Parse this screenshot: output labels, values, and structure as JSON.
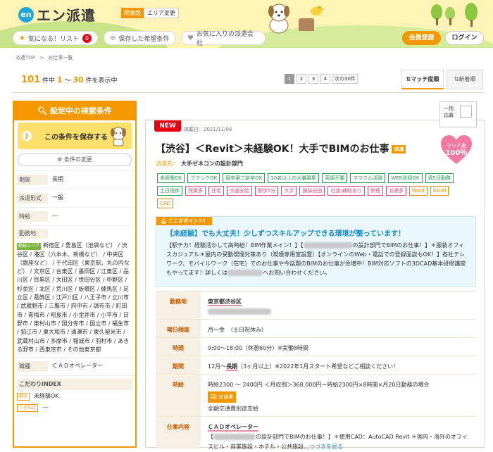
{
  "header": {
    "logo_mark": "en",
    "brand": "エン派遣",
    "region_current": "関東版",
    "region_change": "エリア変更",
    "nav": [
      {
        "label": "気になる！リスト",
        "icon": "star-icon",
        "count": "0"
      },
      {
        "label": "保存した希望条件",
        "icon": "search-icon"
      },
      {
        "label": "お気に入りの派遣会社",
        "icon": "heart-icon"
      }
    ],
    "register": "会員登録",
    "login": "ログイン"
  },
  "breadcrumb": [
    "派遣TOP",
    ">",
    "お仕事一覧"
  ],
  "results": {
    "total": "101",
    "total_unit": "件中",
    "from": "1",
    "sep": "〜",
    "to": "30",
    "suffix": "件を表示中"
  },
  "pager": {
    "pages": [
      "1",
      "2",
      "3",
      "4"
    ],
    "current": "1",
    "next": "次の30件"
  },
  "sort": {
    "match": "マッチ度順",
    "new": "新着順"
  },
  "sidebar": {
    "title": "設定中の検索条件",
    "save": "この条件を保存する",
    "change": "条件の変更",
    "period_label": "期間",
    "period": "長期",
    "type_label": "派遣形式",
    "type": "一般",
    "hours_label": "時給",
    "hours": "---",
    "area_label": "勤務地",
    "area_tag": "勤務エリア",
    "area_text": "新宿区 / 豊島区（池袋など） / 渋谷区 / 港区（六本木、新橋など） / 中央区（銀座など） / 千代田区（東京駅、丸の内など） / 文京区 / 台東区 / 墨田区 / 江東区 / 品川区 / 目黒区 / 大田区 / 世田谷区 / 中野区 / 杉並区 / 北区 / 荒川区 / 板橋区 / 練馬区 / 足立区 / 葛飾区 / 江戸川区 / 八王子市 / 立川市 / 武蔵野市 / 三鷹市 / 府中市 / 調布市 / 町田市 / 青梅市 / 昭島市 / 小金井市 / 小平市 / 日野市 / 東村山市 / 国分寺市 / 国立市 / 福生市 / 狛江市 / 東大和市 / 清瀬市 / 東久留米市 / 武蔵村山市 / 多摩市 / 稲城市 / 羽村市 / あきる野市 / 西東京市 / その他東京都",
    "job_label": "職種",
    "job": "ＣＡＤオペレーター",
    "index_label": "こだわりINDEX",
    "must_label": "絶対",
    "must": "未経験OK",
    "prefer_label": "できれば",
    "prefer": "---"
  },
  "job": {
    "new": "NEW",
    "posted": "掲載日：2021/11/08",
    "bulk": "一括",
    "bulk2": "応募",
    "title": "【渋谷】＜Revit＞未経験OK！大手でBIMのお仕事",
    "haken": "派遣",
    "match_label": "マッチ度",
    "match_value": "100％",
    "company_label": "派遣先：",
    "company": "大手ゼネコンの設計部門",
    "tags": [
      {
        "t": "未経験OK",
        "c": "g"
      },
      {
        "t": "ブランクOK",
        "c": "g"
      },
      {
        "t": "既卒第二新卒OK",
        "c": "g"
      },
      {
        "t": "10名以上の大量募集",
        "c": "g"
      },
      {
        "t": "英語不要",
        "c": "g"
      },
      {
        "t": "ママさん活躍",
        "c": "g"
      },
      {
        "t": "WEB登録OK",
        "c": "g"
      },
      {
        "t": "週5日勤務",
        "c": "g"
      },
      {
        "t": "土日祝休",
        "c": "g"
      },
      {
        "t": "残業多",
        "c": "p"
      },
      {
        "t": "住宅",
        "c": "p"
      },
      {
        "t": "交通支給",
        "c": "p"
      },
      {
        "t": "駅歩5分",
        "c": "p"
      },
      {
        "t": "大手",
        "c": "p"
      },
      {
        "t": "服装自由",
        "c": "p"
      },
      {
        "t": "社食/補助あり",
        "c": "p"
      },
      {
        "t": "禁煙",
        "c": "p"
      },
      {
        "t": "派遣多",
        "c": "p"
      },
      {
        "t": "Word",
        "c": "o"
      },
      {
        "t": "Excel",
        "c": "o"
      },
      {
        "t": "CAD",
        "c": "o"
      }
    ],
    "point_badge": "ここがポイント！",
    "point_head": "【未経験】でも大丈夫！少しずつスキルアップできる環境が整っています！",
    "point_p1": "【駅チカ！経験活かして高時給！BIM作業メイン！】【",
    "point_p2": "の設計部門でBIMのお仕事！】＊服装オフィスカジュアル＊屋内の受動喫煙対策あり（喫煙専用室設置）【オンラインのWeb・電話での登録面談もOK！】各社テレワーク、モバイルワーク（在宅）でのお仕事や今話題のBIMのお仕事が急増中！BIM対応ソフトの3DCAD基本研修講座もやってます！詳しくは",
    "point_p3": "へお問い合わせください。",
    "loc_label": "勤務地",
    "loc": "東京都渋谷区",
    "days_label": "曜日頻度",
    "days": "月〜金　（土日祝休み）",
    "time_label": "時間",
    "time": "9:00〜18:00（休憩60分）※実働8時間",
    "period_label": "期間",
    "period_pre": "12月〜",
    "period_mid": "長期",
    "period_post": "（3ヶ月以上）※2022年1月スタート希望などご相談ください！",
    "pay_label": "時給",
    "pay": "時給2300 〜 2400円 ＜月収例＞368,000円＝時給2300円×8時間×月20日勤務の場合",
    "kotsu": "交通費",
    "kotsu_text": "全額交通費別途支給",
    "work_label": "仕事内容",
    "work_title": "ＣＡＤオペレーター",
    "work_text1": "【",
    "work_text2": "の設計部門でBIMのお仕事！】＊使用CAD：AutoCAD Revit ＊国内・海外のオフィスビル・商業施設・ホテル・公共施設…",
    "more": "つづきを見る"
  }
}
